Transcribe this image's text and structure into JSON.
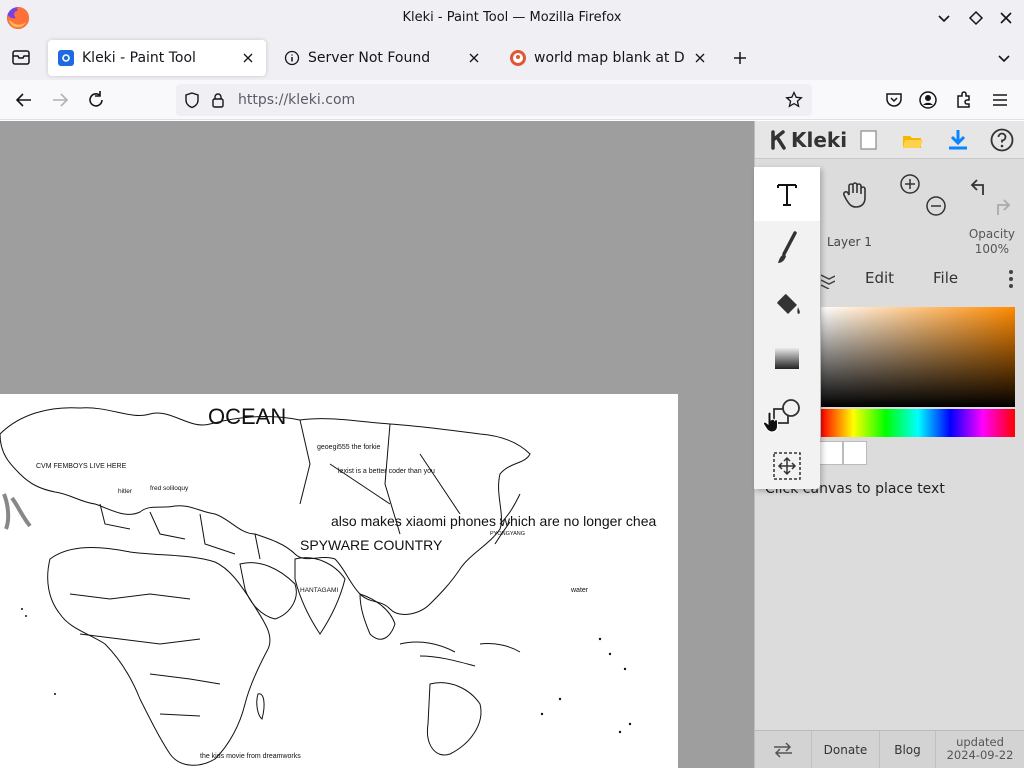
{
  "window": {
    "title": "Kleki - Paint Tool — Mozilla Firefox"
  },
  "tabs": [
    {
      "label": "Kleki - Paint Tool",
      "icon": "kleki-favicon",
      "active": true
    },
    {
      "label": "Server Not Found",
      "icon": "info-icon",
      "active": false
    },
    {
      "label": "world map blank at Duck",
      "icon": "duckduckgo-favicon",
      "active": false
    }
  ],
  "navbar": {
    "url": "https://kleki.com"
  },
  "canvas": {
    "texts": {
      "ocean": "OCEAN",
      "geoegi": "geoegi555 the forkie",
      "lexist": "lexist is a better coder than you",
      "cvm": "CVM FEMBOYS LIVE HERE",
      "hitler": "hitler",
      "fred": "fred soliloquy",
      "xiaomi": "also makes xiaomi phones which are no longer chea",
      "spyware": "SPYWARE COUNTRY",
      "pyongyang": "PYONGYANG",
      "hantagami": "HANTAGAMI",
      "water": "water",
      "kids": "the kids movie from dreamworks"
    }
  },
  "panel": {
    "logo_text": "Kleki",
    "layer_name": "Layer 1",
    "opacity_label": "Opacity",
    "opacity_value": "100%",
    "menu": {
      "edit": "Edit",
      "file": "File"
    },
    "hex_label": "#",
    "hint": "Click canvas to place text",
    "footer": {
      "donate": "Donate",
      "blog": "Blog",
      "updated_label": "updated",
      "updated_date": "2024-09-22"
    }
  },
  "colors": {
    "accent": "#0a84ff",
    "canvas_bg": "#9e9e9e",
    "panel_bg": "#dcdcdc",
    "primary_color": "#ff8a00"
  },
  "tools": [
    "text-tool",
    "brush-tool",
    "fill-tool",
    "gradient-tool",
    "shape-tool",
    "select-tool"
  ]
}
